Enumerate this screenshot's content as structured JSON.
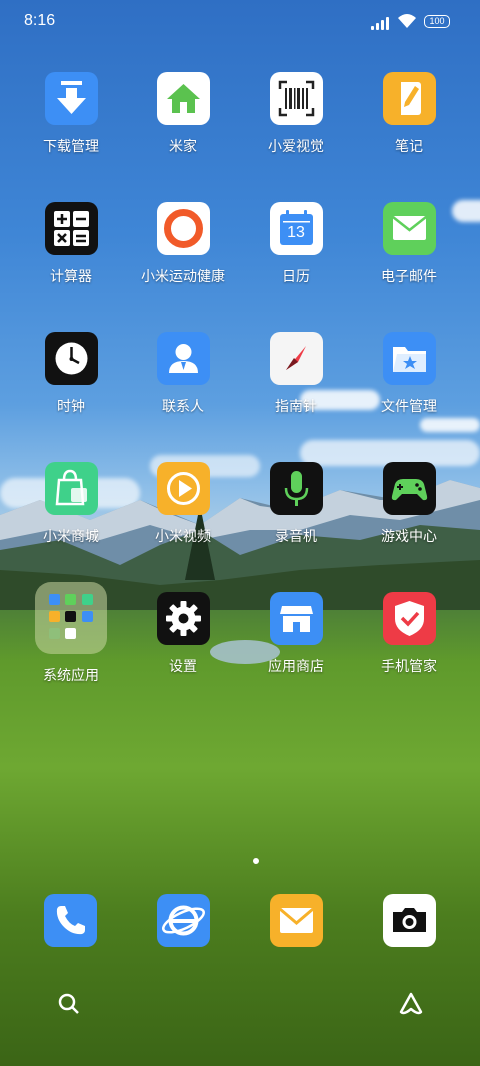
{
  "status_bar": {
    "time": "8:16",
    "battery": "100"
  },
  "apps": [
    {
      "label": "下载管理",
      "icon": "download-icon"
    },
    {
      "label": "米家",
      "icon": "home-icon"
    },
    {
      "label": "小爱视觉",
      "icon": "barcode-scan-icon"
    },
    {
      "label": "笔记",
      "icon": "note-pen-icon"
    },
    {
      "label": "计算器",
      "icon": "calculator-icon"
    },
    {
      "label": "小米运动健康",
      "icon": "ring-icon"
    },
    {
      "label": "日历",
      "icon": "calendar-icon",
      "day": "13"
    },
    {
      "label": "电子邮件",
      "icon": "mail-envelope-icon"
    },
    {
      "label": "时钟",
      "icon": "clock-icon"
    },
    {
      "label": "联系人",
      "icon": "contact-person-icon"
    },
    {
      "label": "指南针",
      "icon": "compass-icon"
    },
    {
      "label": "文件管理",
      "icon": "folder-star-icon"
    },
    {
      "label": "小米商城",
      "icon": "shopping-bag-icon"
    },
    {
      "label": "小米视频",
      "icon": "play-icon"
    },
    {
      "label": "录音机",
      "icon": "microphone-icon"
    },
    {
      "label": "游戏中心",
      "icon": "gamepad-icon"
    },
    {
      "label": "系统应用",
      "icon": "folder-grid-icon"
    },
    {
      "label": "设置",
      "icon": "gear-icon"
    },
    {
      "label": "应用商店",
      "icon": "store-icon"
    },
    {
      "label": "手机管家",
      "icon": "shield-check-icon"
    }
  ],
  "dock": [
    {
      "icon": "phone-icon"
    },
    {
      "icon": "browser-icon"
    },
    {
      "icon": "envelope-icon"
    },
    {
      "icon": "camera-icon"
    }
  ],
  "nav": [
    {
      "icon": "search-icon"
    },
    {
      "icon": "assistant-icon"
    }
  ],
  "colors": {
    "blue": "#3d8ff5",
    "green": "#5fd05b",
    "yellow": "#f7b12a",
    "red": "#ee3b46",
    "black": "#111111",
    "white": "#ffffff"
  }
}
